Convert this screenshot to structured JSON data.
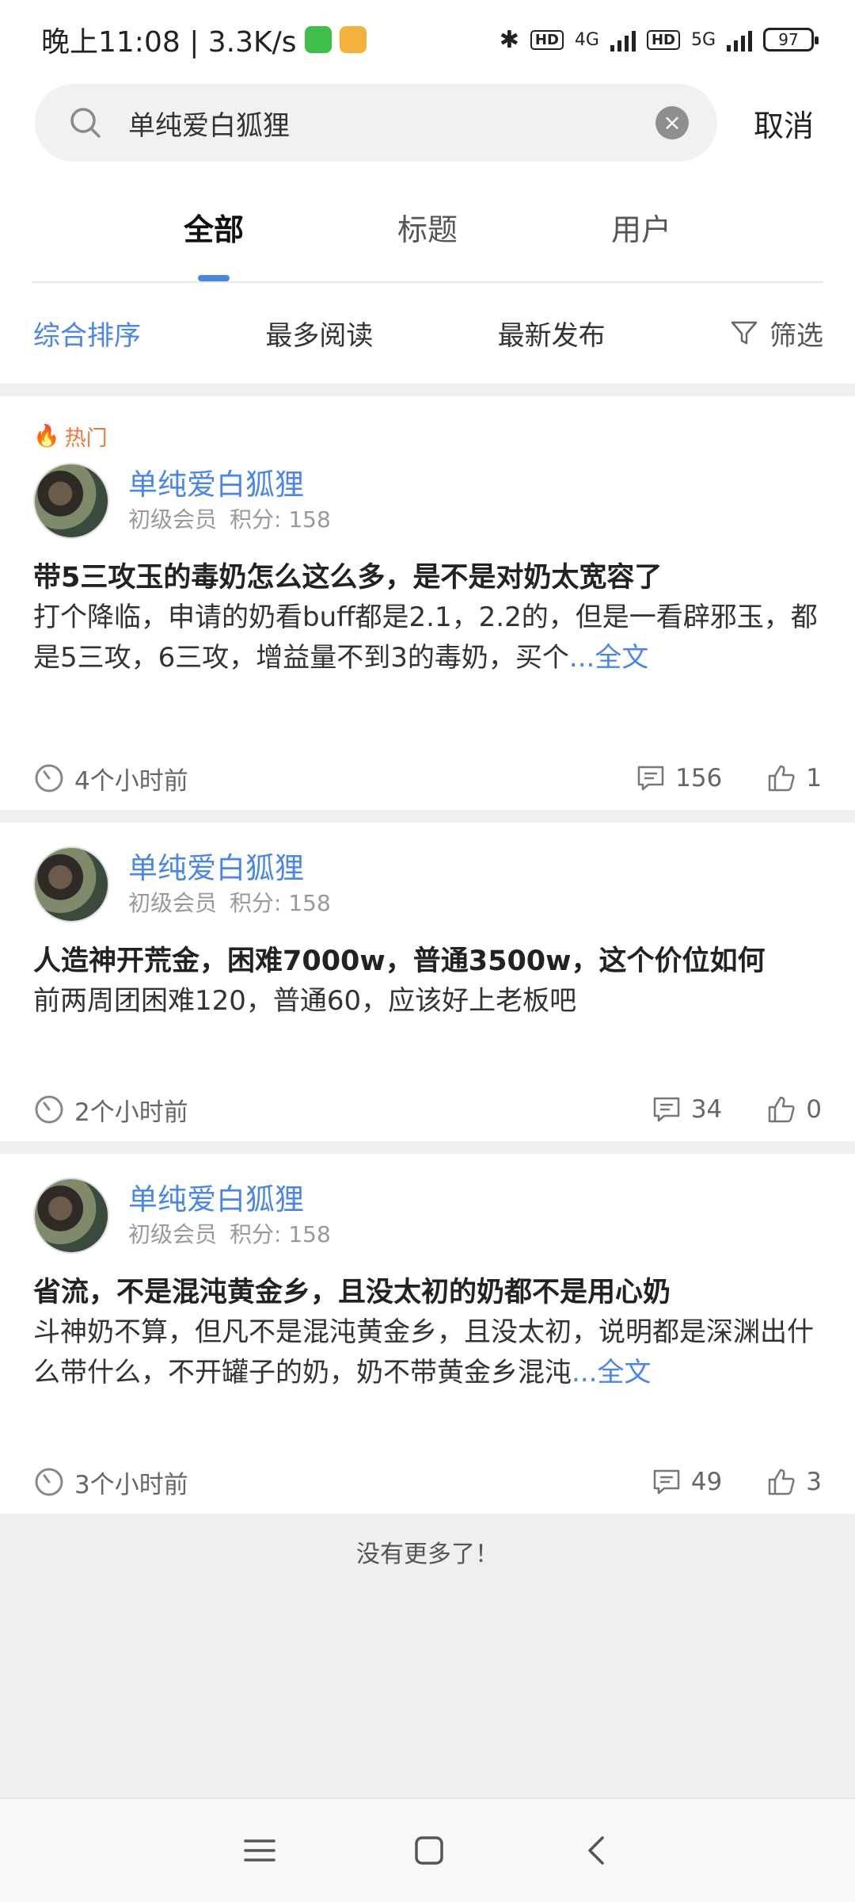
{
  "status_bar": {
    "time_speed": "晚上11:08 | 3.3K/s",
    "network_1": "4G",
    "network_2": "5G",
    "hd": "HD",
    "battery": "97"
  },
  "search": {
    "query": "单纯爱白狐狸",
    "cancel_label": "取消"
  },
  "tabs": [
    {
      "label": "全部",
      "active": true
    },
    {
      "label": "标题",
      "active": false
    },
    {
      "label": "用户",
      "active": false
    }
  ],
  "sort": {
    "items": [
      "综合排序",
      "最多阅读",
      "最新发布"
    ],
    "filter_label": "筛选"
  },
  "posts": [
    {
      "hot_label": "热门",
      "author": "单纯爱白狐狸",
      "level": "初级会员",
      "points": "积分: 158",
      "title": "带5三攻玉的毒奶怎么这么多，是不是对奶太宽容了",
      "body": "打个降临，申请的奶看buff都是2.1，2.2的，但是一看辟邪玉，都是5三攻，6三攻，增益量不到3的毒奶，买个",
      "more": "...全文",
      "time": "4个小时前",
      "comments": "156",
      "likes": "1"
    },
    {
      "author": "单纯爱白狐狸",
      "level": "初级会员",
      "points": "积分: 158",
      "title": "人造神开荒金，困难7000w，普通3500w，这个价位如何",
      "body": "前两周团困难120，普通60，应该好上老板吧",
      "time": "2个小时前",
      "comments": "34",
      "likes": "0"
    },
    {
      "author": "单纯爱白狐狸",
      "level": "初级会员",
      "points": "积分: 158",
      "title": "省流，不是混沌黄金乡，且没太初的奶都不是用心奶",
      "body": "斗神奶不算，但凡不是混沌黄金乡，且没太初，说明都是深渊出什么带什么，不开罐子的奶，奶不带黄金乡混沌",
      "more": "...全文",
      "time": "3个小时前",
      "comments": "49",
      "likes": "3"
    }
  ],
  "no_more": "没有更多了！"
}
